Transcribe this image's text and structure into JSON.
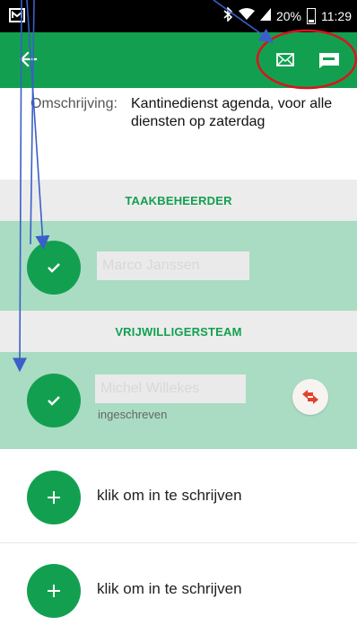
{
  "status_bar": {
    "battery_percent": "20%",
    "time": "11:29"
  },
  "app_bar": {
    "back_icon": "arrow-left-icon",
    "mail_icon": "envelope-icon",
    "message_icon": "message-icon"
  },
  "description": {
    "label": "Omschrijving:",
    "value": "Kantinedienst agenda, voor alle diensten op zaterdag"
  },
  "sections": {
    "manager_header": "TAAKBEHEERDER",
    "team_header": "VRIJWILLIGERSTEAM"
  },
  "manager": {
    "name": "Marco  Janssen"
  },
  "volunteer": {
    "name": "Michel  Willekes",
    "status": "ingeschreven"
  },
  "signup_slots": [
    {
      "label": "klik om in te schrijven"
    },
    {
      "label": "klik om in te schrijven"
    }
  ],
  "colors": {
    "primary": "#12a050",
    "light_green": "#a9dcc3",
    "annotation_red": "#d9141e",
    "annotation_blue": "#3a5fc8",
    "swap_icon": "#e0442a"
  }
}
